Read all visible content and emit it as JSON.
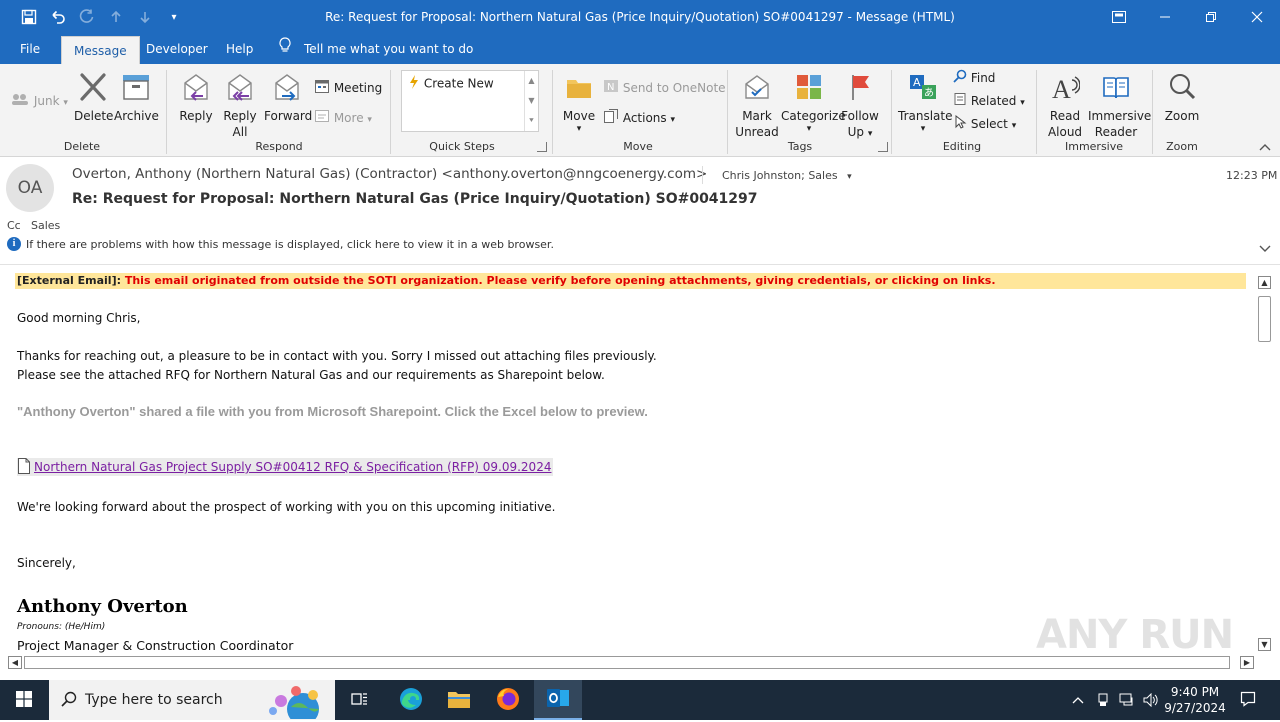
{
  "window": {
    "title": "Re: Request for Proposal: Northern Natural Gas (Price Inquiry/Quotation) SO#0041297  -  Message (HTML)"
  },
  "menu": {
    "file": "File",
    "message": "Message",
    "developer": "Developer",
    "help": "Help",
    "tell_me": "Tell me what you want to do"
  },
  "ribbon": {
    "junk": "Junk",
    "delete": "Delete",
    "archive": "Archive",
    "delete_group": "Delete",
    "reply": "Reply",
    "reply_all_1": "Reply",
    "reply_all_2": "All",
    "forward": "Forward",
    "meeting": "Meeting",
    "more": "More",
    "respond_group": "Respond",
    "create_new": "Create New",
    "quick_steps_group": "Quick Steps",
    "move": "Move",
    "send_to_onenote": "Send to OneNote",
    "actions": "Actions",
    "move_group": "Move",
    "mark_unread_1": "Mark",
    "mark_unread_2": "Unread",
    "categorize": "Categorize",
    "follow_up_1": "Follow",
    "follow_up_2": "Up",
    "tags_group": "Tags",
    "translate": "Translate",
    "find": "Find",
    "related": "Related",
    "select": "Select",
    "editing_group": "Editing",
    "read_aloud_1": "Read",
    "read_aloud_2": "Aloud",
    "immersive_reader_1": "Immersive",
    "immersive_reader_2": "Reader",
    "immersive_group": "Immersive",
    "zoom": "Zoom",
    "zoom_group": "Zoom"
  },
  "message": {
    "avatar_initials": "OA",
    "from": "Overton, Anthony (Northern Natural Gas) (Contractor) <anthony.overton@nngcoenergy.com>",
    "to": "Chris Johnston; Sales",
    "time": "12:23 PM",
    "subject": "Re: Request for Proposal: Northern Natural Gas (Price Inquiry/Quotation) SO#0041297",
    "cc_label": "Cc",
    "cc_value": "Sales",
    "info_bar": "If there are problems with how this message is displayed, click here to view it in a web browser."
  },
  "body": {
    "external_label": "[External Email]:",
    "external_warning": " This email originated from outside the SOTI organization.  Please verify before opening attachments, giving credentials, or clicking  on links.",
    "greeting": "Good morning Chris,",
    "line1": "Thanks for reaching out, a pleasure to be in contact with you. Sorry I missed out attaching files previously.",
    "line2": "Please see the attached RFQ for Northern Natural Gas and our requirements as Sharepoint below.",
    "shared_notice": "\"Anthony Overton\" shared a file with you from Microsoft Sharepoint. Click the Excel below to preview.",
    "file_link": "Northern Natural Gas  Project  Supply SO#00412 RFQ & Specification (RFP)  09.09.2024",
    "looking_forward": "We're looking forward about the prospect of working with you on this upcoming initiative.",
    "sincerely": "Sincerely,",
    "sig_name": "Anthony Overton",
    "pronouns": "Pronouns: (He/Him)",
    "sig_title": "Project Manager & Construction Coordinator"
  },
  "watermark": "ANY RUN",
  "taskbar": {
    "search_placeholder": "Type here to search",
    "time": "9:40 PM",
    "date": "9/27/2024"
  },
  "colors": {
    "title_blue": "#1f6bbf",
    "warning_bg": "#ffe69a",
    "warning_red": "#e00000",
    "link_purple": "#7b1fa2",
    "taskbar": "#1b2a3a"
  }
}
